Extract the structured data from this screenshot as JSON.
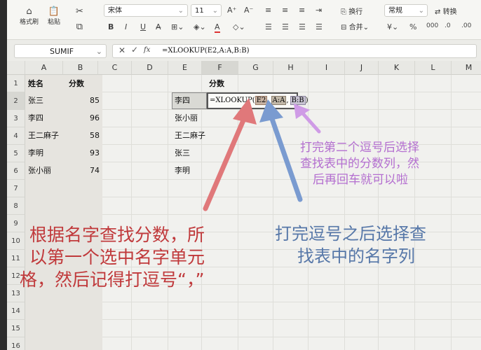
{
  "ribbon": {
    "format_painter": "格式刷",
    "paste": "粘贴",
    "font_name": "宋体",
    "font_size": "11",
    "wrap_text": "换行",
    "merge": "合并",
    "number_format": "常规",
    "convert": "转换"
  },
  "formula_bar": {
    "name_box": "SUMIF",
    "fx": "fx",
    "formula": "=XLOOKUP(E2,A:A,B:B)"
  },
  "columns": [
    "A",
    "B",
    "C",
    "D",
    "E",
    "F",
    "G",
    "H",
    "I",
    "J",
    "K",
    "L",
    "M"
  ],
  "rows": [
    "1",
    "2",
    "3",
    "4",
    "5",
    "6",
    "7",
    "8",
    "9",
    "10",
    "11",
    "12",
    "13",
    "14",
    "15",
    "16"
  ],
  "table_a": {
    "header_name": "姓名",
    "header_score": "分数",
    "names": [
      "张三",
      "李四",
      "王二麻子",
      "李明",
      "张小丽"
    ],
    "scores": [
      "85",
      "96",
      "58",
      "93",
      "74"
    ]
  },
  "table_e": {
    "header_score": "分数",
    "names": [
      "李四",
      "张小丽",
      "王二麻子",
      "张三",
      "李明"
    ],
    "f2_formula": {
      "prefix": "=XLOOKUP(",
      "arg1": "E2",
      "arg2": "A:A",
      "arg3": "B:B",
      "suffix": ")"
    }
  },
  "annotations": {
    "red": [
      "根据名字查找分数，所",
      "以第一个选中名字单元",
      "格，然后记得打逗号“，”"
    ],
    "blue": [
      "打完逗号之后选择查",
      "找表中的名字列"
    ],
    "purple": [
      "打完第二个逗号后选择",
      "查找表中的分数列，然",
      "后再回车就可以啦"
    ]
  },
  "colors": {
    "red": "#c0393b",
    "blue": "#5677a8",
    "purple": "#b46fd0"
  }
}
